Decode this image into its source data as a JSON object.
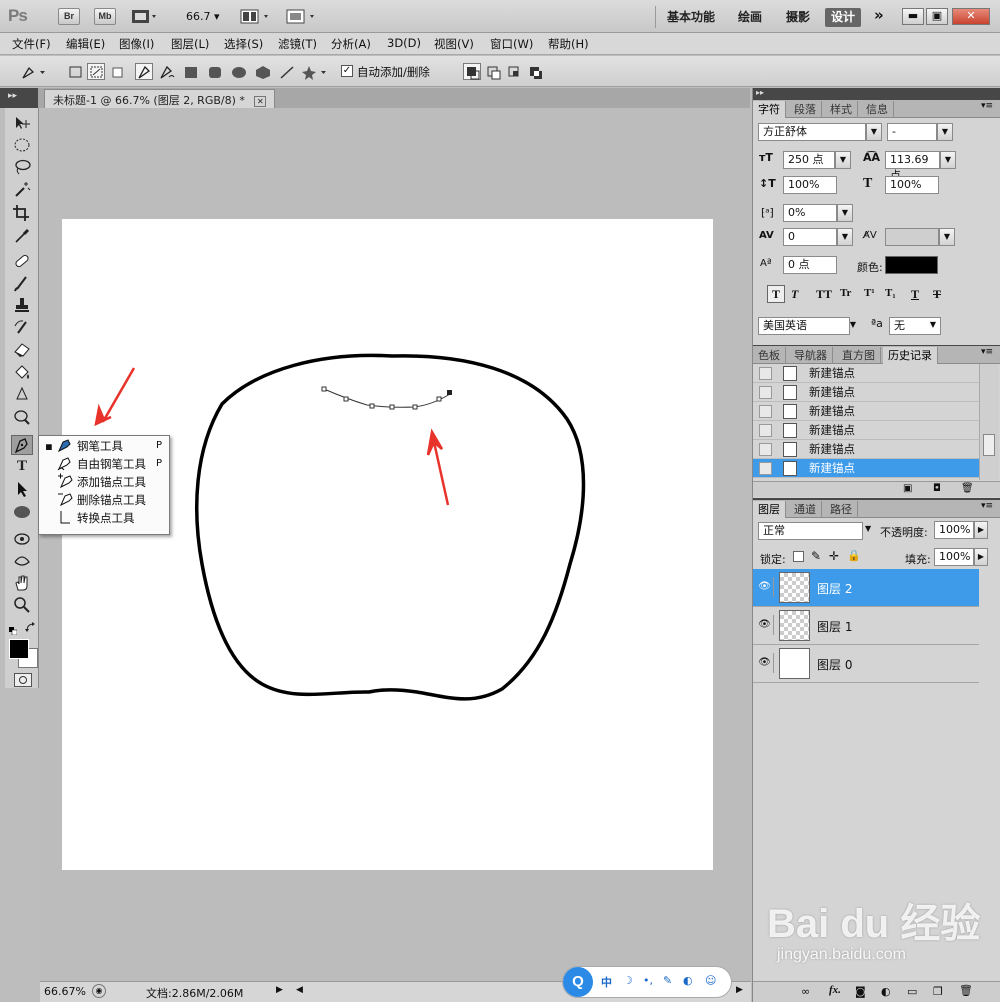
{
  "app": {
    "logo": "Ps",
    "bridge_btn": "Br",
    "minibridge_btn": "Mb",
    "zoom_dropdown": "66.7",
    "workspaces": [
      "基本功能",
      "绘画",
      "摄影",
      "设计"
    ],
    "active_workspace": "设计",
    "more_glyph": "»"
  },
  "menu": [
    "文件(F)",
    "编辑(E)",
    "图像(I)",
    "图层(L)",
    "选择(S)",
    "滤镜(T)",
    "分析(A)",
    "3D(D)",
    "视图(V)",
    "窗口(W)",
    "帮助(H)"
  ],
  "options_bar": {
    "auto_add_delete_label": "自动添加/删除",
    "auto_add_delete_checked": true
  },
  "document": {
    "tab_title": "未标题-1 @ 66.7% (图层 2, RGB/8) *",
    "close_glyph": "✕"
  },
  "tool_flyout": {
    "items": [
      {
        "label": "钢笔工具",
        "key": "P",
        "active": true
      },
      {
        "label": "自由钢笔工具",
        "key": "P",
        "active": false
      },
      {
        "label": "添加锚点工具",
        "key": "",
        "active": false
      },
      {
        "label": "删除锚点工具",
        "key": "",
        "active": false
      },
      {
        "label": "转换点工具",
        "key": "",
        "active": false
      }
    ]
  },
  "status": {
    "zoom": "66.67%",
    "doc_size": "文档:2.86M/2.06M"
  },
  "character_panel": {
    "tabs": [
      "字符",
      "段落",
      "样式",
      "信息"
    ],
    "font_family": "方正舒体",
    "font_style": "-",
    "font_size": "250 点",
    "leading": "113.69 点",
    "vertical_scale": "100%",
    "horizontal_scale": "100%",
    "tsume": "0%",
    "kerning": "0",
    "baseline_shift": "0 点",
    "color_label": "颜色:",
    "color_value": "#000000",
    "language": "美国英语",
    "aa_label": "ªa",
    "antialias": "无"
  },
  "history_panel": {
    "tabs": [
      "色板",
      "导航器",
      "直方图",
      "历史记录"
    ],
    "active_tab": "历史记录",
    "items": [
      "新建锚点",
      "新建锚点",
      "新建锚点",
      "新建锚点",
      "新建锚点",
      "新建锚点"
    ],
    "selected_index": 5
  },
  "layers_panel": {
    "tabs": [
      "图层",
      "通道",
      "路径"
    ],
    "blend_mode": "正常",
    "opacity_label": "不透明度:",
    "opacity": "100%",
    "lock_label": "锁定:",
    "fill_label": "填充:",
    "fill": "100%",
    "layers": [
      {
        "name": "图层 2",
        "selected": true,
        "transparent": true
      },
      {
        "name": "图层 1",
        "selected": false,
        "transparent": true
      },
      {
        "name": "图层 0",
        "selected": false,
        "transparent": false
      }
    ]
  },
  "ime_bar": {
    "mode": "中"
  },
  "watermark": {
    "brand": "Bai du 经验",
    "url": "jingyan.baidu.com"
  },
  "colors": {
    "selection_blue": "#3d9bea",
    "arrow_red": "#e8332a"
  }
}
